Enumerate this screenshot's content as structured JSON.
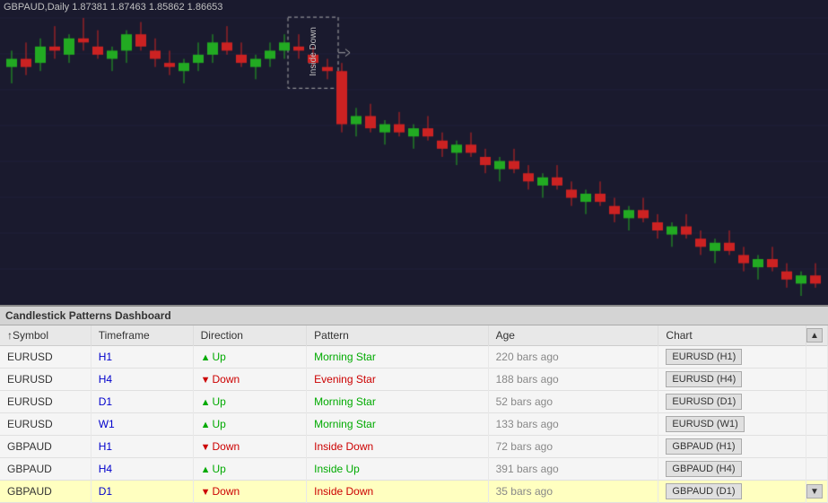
{
  "chart": {
    "title": "GBPAUD,Daily  1.87381 1.87463 1.85862 1.86653",
    "insidedown_label": "Inside Down",
    "background": "#1a1a2e"
  },
  "dashboard": {
    "title": "Candlestick Patterns Dashboard",
    "columns": [
      "↑Symbol",
      "Timeframe",
      "Direction",
      "Pattern",
      "Age",
      "Chart"
    ],
    "rows": [
      {
        "symbol": "EURUSD",
        "tf": "H1",
        "dir": "Up",
        "pattern": "Morning Star",
        "age": "220 bars ago",
        "chart": "EURUSD (H1)",
        "highlighted": false
      },
      {
        "symbol": "EURUSD",
        "tf": "H4",
        "dir": "Down",
        "pattern": "Evening Star",
        "age": "188 bars ago",
        "chart": "EURUSD (H4)",
        "highlighted": false
      },
      {
        "symbol": "EURUSD",
        "tf": "D1",
        "dir": "Up",
        "pattern": "Morning Star",
        "age": "52 bars ago",
        "chart": "EURUSD (D1)",
        "highlighted": false
      },
      {
        "symbol": "EURUSD",
        "tf": "W1",
        "dir": "Up",
        "pattern": "Morning Star",
        "age": "133 bars ago",
        "chart": "EURUSD (W1)",
        "highlighted": false
      },
      {
        "symbol": "GBPAUD",
        "tf": "H1",
        "dir": "Down",
        "pattern": "Inside Down",
        "age": "72 bars ago",
        "chart": "GBPAUD (H1)",
        "highlighted": false
      },
      {
        "symbol": "GBPAUD",
        "tf": "H4",
        "dir": "Up",
        "pattern": "Inside Up",
        "age": "391 bars ago",
        "chart": "GBPAUD (H4)",
        "highlighted": false
      },
      {
        "symbol": "GBPAUD",
        "tf": "D1",
        "dir": "Down",
        "pattern": "Inside Down",
        "age": "35 bars ago",
        "chart": "GBPAUD (D1)",
        "highlighted": true
      }
    ]
  }
}
